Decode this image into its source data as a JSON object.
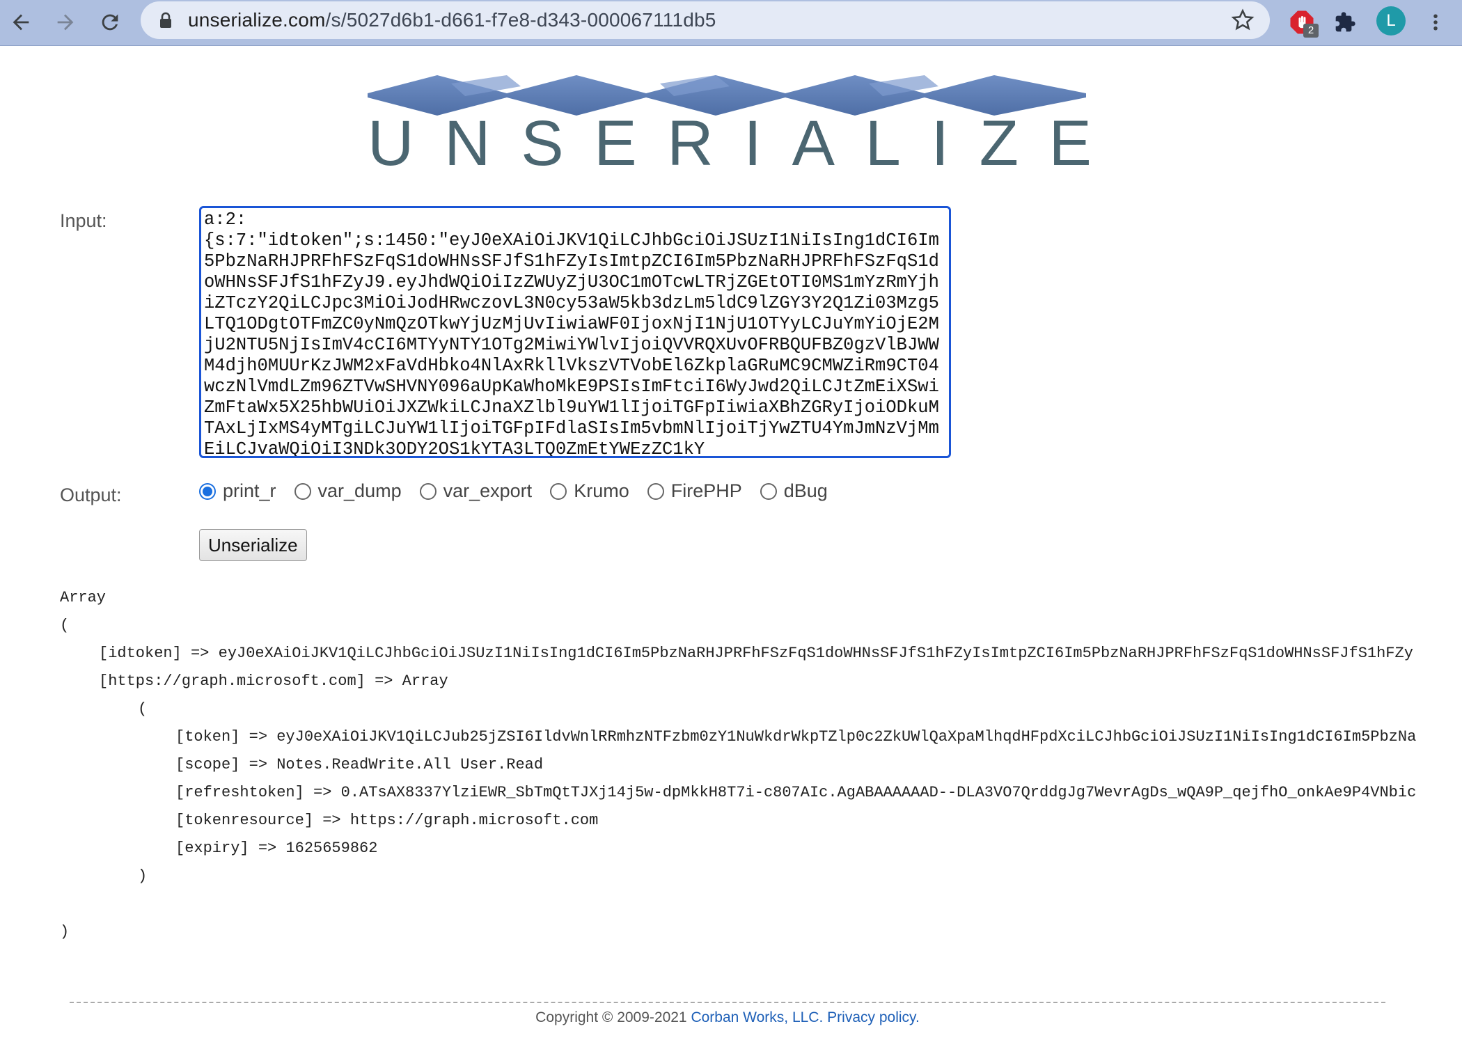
{
  "browser": {
    "url_domain": "unserialize.com",
    "url_path": "/s/5027d6b1-d661-f7e8-d343-000067111db5",
    "extension_badge": "2",
    "avatar_letter": "L"
  },
  "logo": {
    "letters": [
      "U",
      "N",
      "S",
      "E",
      "R",
      "I",
      "A",
      "L",
      "I",
      "Z",
      "E"
    ]
  },
  "form": {
    "input_label": "Input:",
    "input_value": "a:2:\n{s:7:\"idtoken\";s:1450:\"eyJ0eXAiOiJKV1QiLCJhbGciOiJSUzI1NiIsIng1dCI6Im5PbzNaRHJPRFhFSzFqS1doWHNsSFJfS1hFZyIsImtpZCI6Im5PbzNaRHJPRFhFSzFqS1doWHNsSFJfS1hFZyJ9.eyJhdWQiOiIzZWUyZjU3OC1mOTcwLTRjZGEtOTI0MS1mYzRmYjhiZTczY2QiLCJpc3MiOiJodHRwczovL3N0cy53aW5kb3dzLm5ldC9lZGY3Y2Q1Zi03Mzg5LTQ1ODgtOTFmZC0yNmQzOTkwYjUzMjUvIiwiaWF0IjoxNjI1NjU1OTYyLCJuYmYiOjE2MjU2NTU5NjIsImV4cCI6MTYyNTY1OTg2MiwiYWlvIjoiQVVRQXUvOFRBQUFBZ0gzVlBJWWM4djh0MUUrKzJWM2xFaVdHbko4NlAxRkllVkszVTVobEl6ZkplaGRuMC9CMWZiRm9CT04wczNlVmdLZm96ZTVwSHVNY096aUpKaWhoMkE9PSIsImFtciI6WyJwd2QiLCJtZmEiXSwiZmFtaWx5X25hbWUiOiJXZWkiLCJnaXZlbl9uYW1lIjoiTGFpIiwiaXBhZGRyIjoiODkuMTAxLjIxMS4yMTgiLCJuYW1lIjoiTGFpIFdlaSIsIm5vbmNlIjoiTjYwZTU4YmJmNzVjMmEiLCJvaWQiOiI3NDk3ODY2OS1kYTA3LTQ0ZmEtYWEzZC1kY",
    "output_label": "Output:",
    "options": [
      {
        "label": "print_r",
        "checked": true
      },
      {
        "label": "var_dump",
        "checked": false
      },
      {
        "label": "var_export",
        "checked": false
      },
      {
        "label": "Krumo",
        "checked": false
      },
      {
        "label": "FirePHP",
        "checked": false
      },
      {
        "label": "dBug",
        "checked": false
      }
    ],
    "submit_label": "Unserialize"
  },
  "output": {
    "l1": "Array",
    "l2": "(",
    "l3": "[idtoken] => eyJ0eXAiOiJKV1QiLCJhbGciOiJSUzI1NiIsIng1dCI6Im5PbzNaRHJPRFhFSzFqS1doWHNsSFJfS1hFZyIsImtpZCI6Im5PbzNaRHJPRFhFSzFqS1doWHNsSFJfS1hFZy",
    "l4": "[https://graph.microsoft.com] => Array",
    "l5": "(",
    "l6": "[token] => eyJ0eXAiOiJKV1QiLCJub25jZSI6IldvWnlRRmhzNTFzbm0zY1NuWkdrWkpTZlp0c2ZkUWlQaXpaMlhqdHFpdXciLCJhbGciOiJSUzI1NiIsIng1dCI6Im5PbzNa",
    "l7": "[scope] => Notes.ReadWrite.All User.Read",
    "l8": "[refreshtoken] => 0.ATsAX8337YlziEWR_SbTmQtTJXj14j5w-dpMkkH8T7i-c807AIc.AgABAAAAAAD--DLA3VO7QrddgJg7WevrAgDs_wQA9P_qejfhO_onkAe9P4VNbic",
    "l9": "[tokenresource] => https://graph.microsoft.com",
    "l10": "[expiry] => 1625659862",
    "l11": ")",
    "l12": ")"
  },
  "footer": {
    "copyright": "Copyright © 2009-2021 ",
    "company_link": "Corban Works, LLC.",
    "privacy_link": "Privacy policy."
  }
}
